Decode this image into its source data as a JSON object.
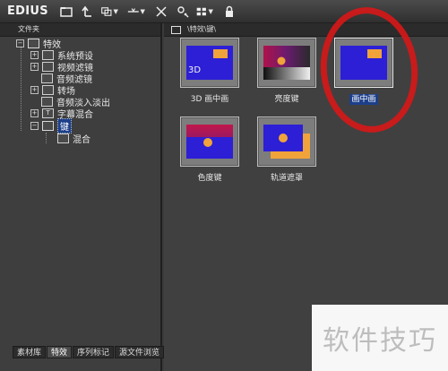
{
  "app": {
    "title": "EDIUS"
  },
  "toolbar": {
    "icons": [
      "folder-icon",
      "up-folder-icon",
      "copy-icon",
      "split-icon",
      "close-icon",
      "settings-icon",
      "view-icon",
      "lock-icon"
    ]
  },
  "left_panel": {
    "header": "文件夹",
    "tree": [
      {
        "label": "特效"
      },
      {
        "label": "系统预设"
      },
      {
        "label": "视频滤镜"
      },
      {
        "label": "音频滤镜"
      },
      {
        "label": "转场"
      },
      {
        "label": "音频淡入淡出"
      },
      {
        "label": "字幕混合"
      },
      {
        "label": "键"
      },
      {
        "label": "混合"
      }
    ]
  },
  "tabs": [
    {
      "label": "素材库"
    },
    {
      "label": "特效"
    },
    {
      "label": "序列标记"
    },
    {
      "label": "源文件浏览"
    }
  ],
  "right_panel": {
    "path": "\\特效\\键\\",
    "tiles": [
      {
        "label": "3D 画中画",
        "badge": "3D"
      },
      {
        "label": "亮度键"
      },
      {
        "label": "画中画"
      },
      {
        "label": "色度键"
      },
      {
        "label": "轨道遮罩"
      }
    ]
  },
  "watermark": {
    "text": "软件技巧"
  },
  "colors": {
    "selection": "#1d3f8a",
    "annotation": "#d41818",
    "thumb_blue": "#2c1fd6",
    "thumb_orange": "#f0a33a"
  }
}
